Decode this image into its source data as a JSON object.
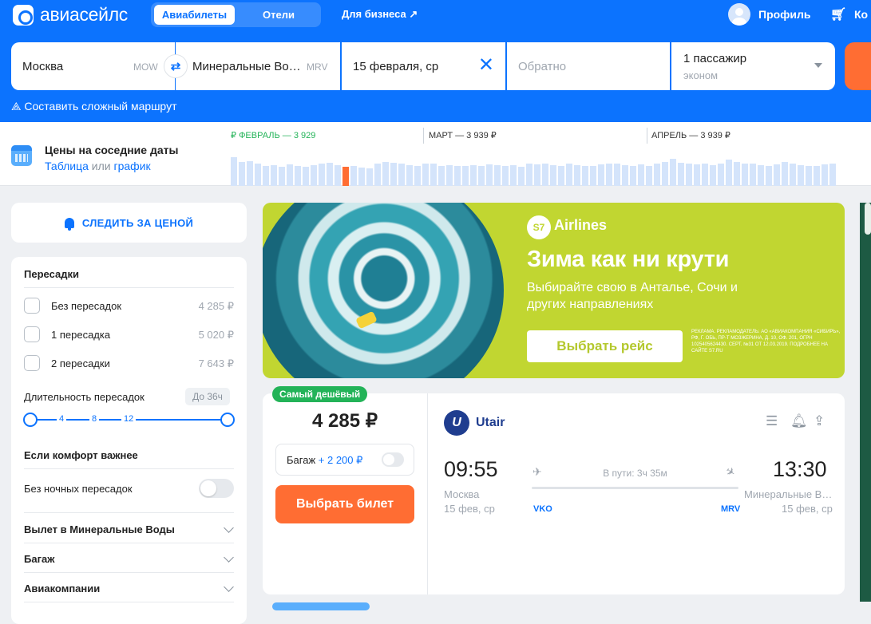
{
  "header": {
    "logo_text": "авиасейлс",
    "tabs": [
      "Авиабилеты",
      "Отели"
    ],
    "business_link": "Для бизнеса ↗",
    "profile": "Профиль",
    "cart": "Ко"
  },
  "search": {
    "from_city": "Москва",
    "from_code": "MOW",
    "to_city": "Минеральные Во…",
    "to_code": "MRV",
    "depart_date": "15 февраля, ср",
    "return_placeholder": "Обратно",
    "passengers": "1 пассажир",
    "cabin_class": "эконом",
    "complex_route": "Составить сложный маршрут"
  },
  "nearby_dates": {
    "title": "Цены на соседние даты",
    "link_table": "Таблица",
    "or_text": "или",
    "link_chart": "график",
    "months": [
      "ФЕВРАЛЬ — 3 929 ₽",
      "МАРТ — 3 939 ₽",
      "АПРЕЛЬ — 3 939 ₽"
    ],
    "bar_levels": [
      0.72,
      0.6,
      0.62,
      0.55,
      0.5,
      0.52,
      0.48,
      0.53,
      0.5,
      0.47,
      0.51,
      0.55,
      0.58,
      0.52,
      0.48,
      0.5,
      0.45,
      0.44,
      0.55,
      0.6,
      0.58,
      0.55,
      0.52,
      0.5,
      0.56,
      0.55,
      0.5,
      0.52,
      0.49,
      0.5,
      0.51,
      0.5,
      0.53,
      0.52,
      0.5,
      0.51,
      0.48,
      0.55,
      0.53,
      0.57,
      0.52,
      0.5,
      0.56,
      0.52,
      0.49,
      0.5,
      0.53,
      0.55,
      0.57,
      0.52,
      0.5,
      0.54,
      0.5,
      0.55,
      0.6,
      0.67,
      0.58,
      0.55,
      0.53,
      0.55,
      0.52,
      0.57,
      0.65,
      0.6,
      0.55,
      0.55,
      0.52,
      0.5,
      0.53,
      0.6,
      0.55,
      0.52,
      0.5,
      0.49,
      0.53,
      0.55
    ],
    "selected_bar_index": 14,
    "bar_color": "#d4e4fb",
    "selected_color": "#ff6d33"
  },
  "follow_price": "СЛЕДИТЬ ЗА ЦЕНОЙ",
  "filters": {
    "transfers_title": "Пересадки",
    "options": [
      {
        "label": "Без пересадок",
        "price": "4 285 ₽"
      },
      {
        "label": "1 пересадка",
        "price": "5 020 ₽"
      },
      {
        "label": "2 пересадки",
        "price": "7 643 ₽"
      }
    ],
    "duration_title": "Длительность пересадок",
    "duration_badge": "До 36ч",
    "duration_ticks": [
      "4",
      "8",
      "12"
    ],
    "comfort_title": "Если комфорт важнее",
    "no_night": "Без ночных пересадок",
    "sections": [
      "Вылет в Минеральные Воды",
      "Багаж",
      "Авиакомпании"
    ]
  },
  "banner": {
    "brand_mark": "S7",
    "brand": "Airlines",
    "headline": "Зима как ни крути",
    "subtext": "Выбирайте свою в Анталье, Сочи и других направлениях",
    "button": "Выбрать рейс",
    "legal": "РЕКЛАМА. РЕКЛАМОДАТЕЛЬ: АО «АВИАКОМПАНИЯ «СИБИРЬ», РФ, Г. ОБЬ, ПР-Т МОЗЖЕРИНА, Д. 10, ОФ. 201, ОГРН 1025405624430. СЕРТ. №31 ОТ 12.03.2019. ПОДРОБНЕЕ НА САЙТЕ S7.RU"
  },
  "ticket": {
    "badge": "Самый дешёвый",
    "price": "4 285 ₽",
    "baggage_label": "Багаж",
    "baggage_price": "+ 2 200 ₽",
    "select_button": "Выбрать билет",
    "airline_mark": "U",
    "airline": "Utair",
    "depart_time": "09:55",
    "arrive_time": "13:30",
    "depart_city": "Москва",
    "arrive_city": "Минеральные В…",
    "depart_date": "15 фев, ср",
    "arrive_date": "15 фев, ср",
    "duration": "В пути: 3ч 35м",
    "depart_iata": "VKO",
    "arrive_iata": "MRV"
  }
}
